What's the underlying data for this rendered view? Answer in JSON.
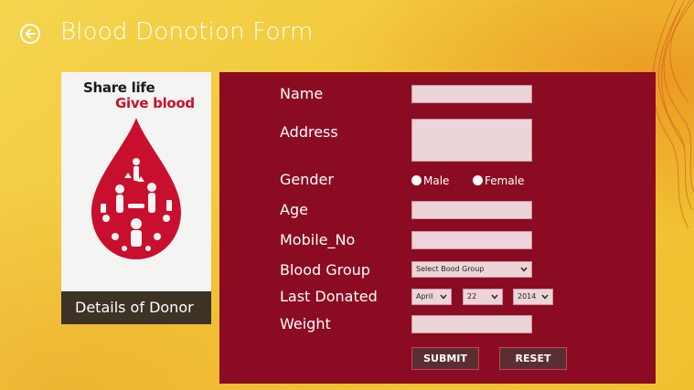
{
  "header": {
    "title": "Blood Donotion Form"
  },
  "poster": {
    "line1": "Share life",
    "line2": "Give blood",
    "caption": "Details of Donor"
  },
  "form": {
    "name_label": "Name",
    "address_label": "Address",
    "gender_label": "Gender",
    "gender_options": [
      "Male",
      "Female"
    ],
    "age_label": "Age",
    "mobile_label": "Mobile_No",
    "blood_group_label": "Blood Group",
    "blood_group_value": "Select Bood Group",
    "last_donated_label": "Last Donated",
    "last_donated": {
      "month": "April",
      "day": "22",
      "year": "2014"
    },
    "weight_label": "Weight",
    "submit_label": "SUBMIT",
    "reset_label": "RESET"
  },
  "colors": {
    "background": "#f2c93a",
    "panel": "#8b0b22",
    "input": "#ecd4d8",
    "button": "#5b2e33",
    "caption_bar": "#3c3226",
    "poster_red": "#c8102e"
  }
}
